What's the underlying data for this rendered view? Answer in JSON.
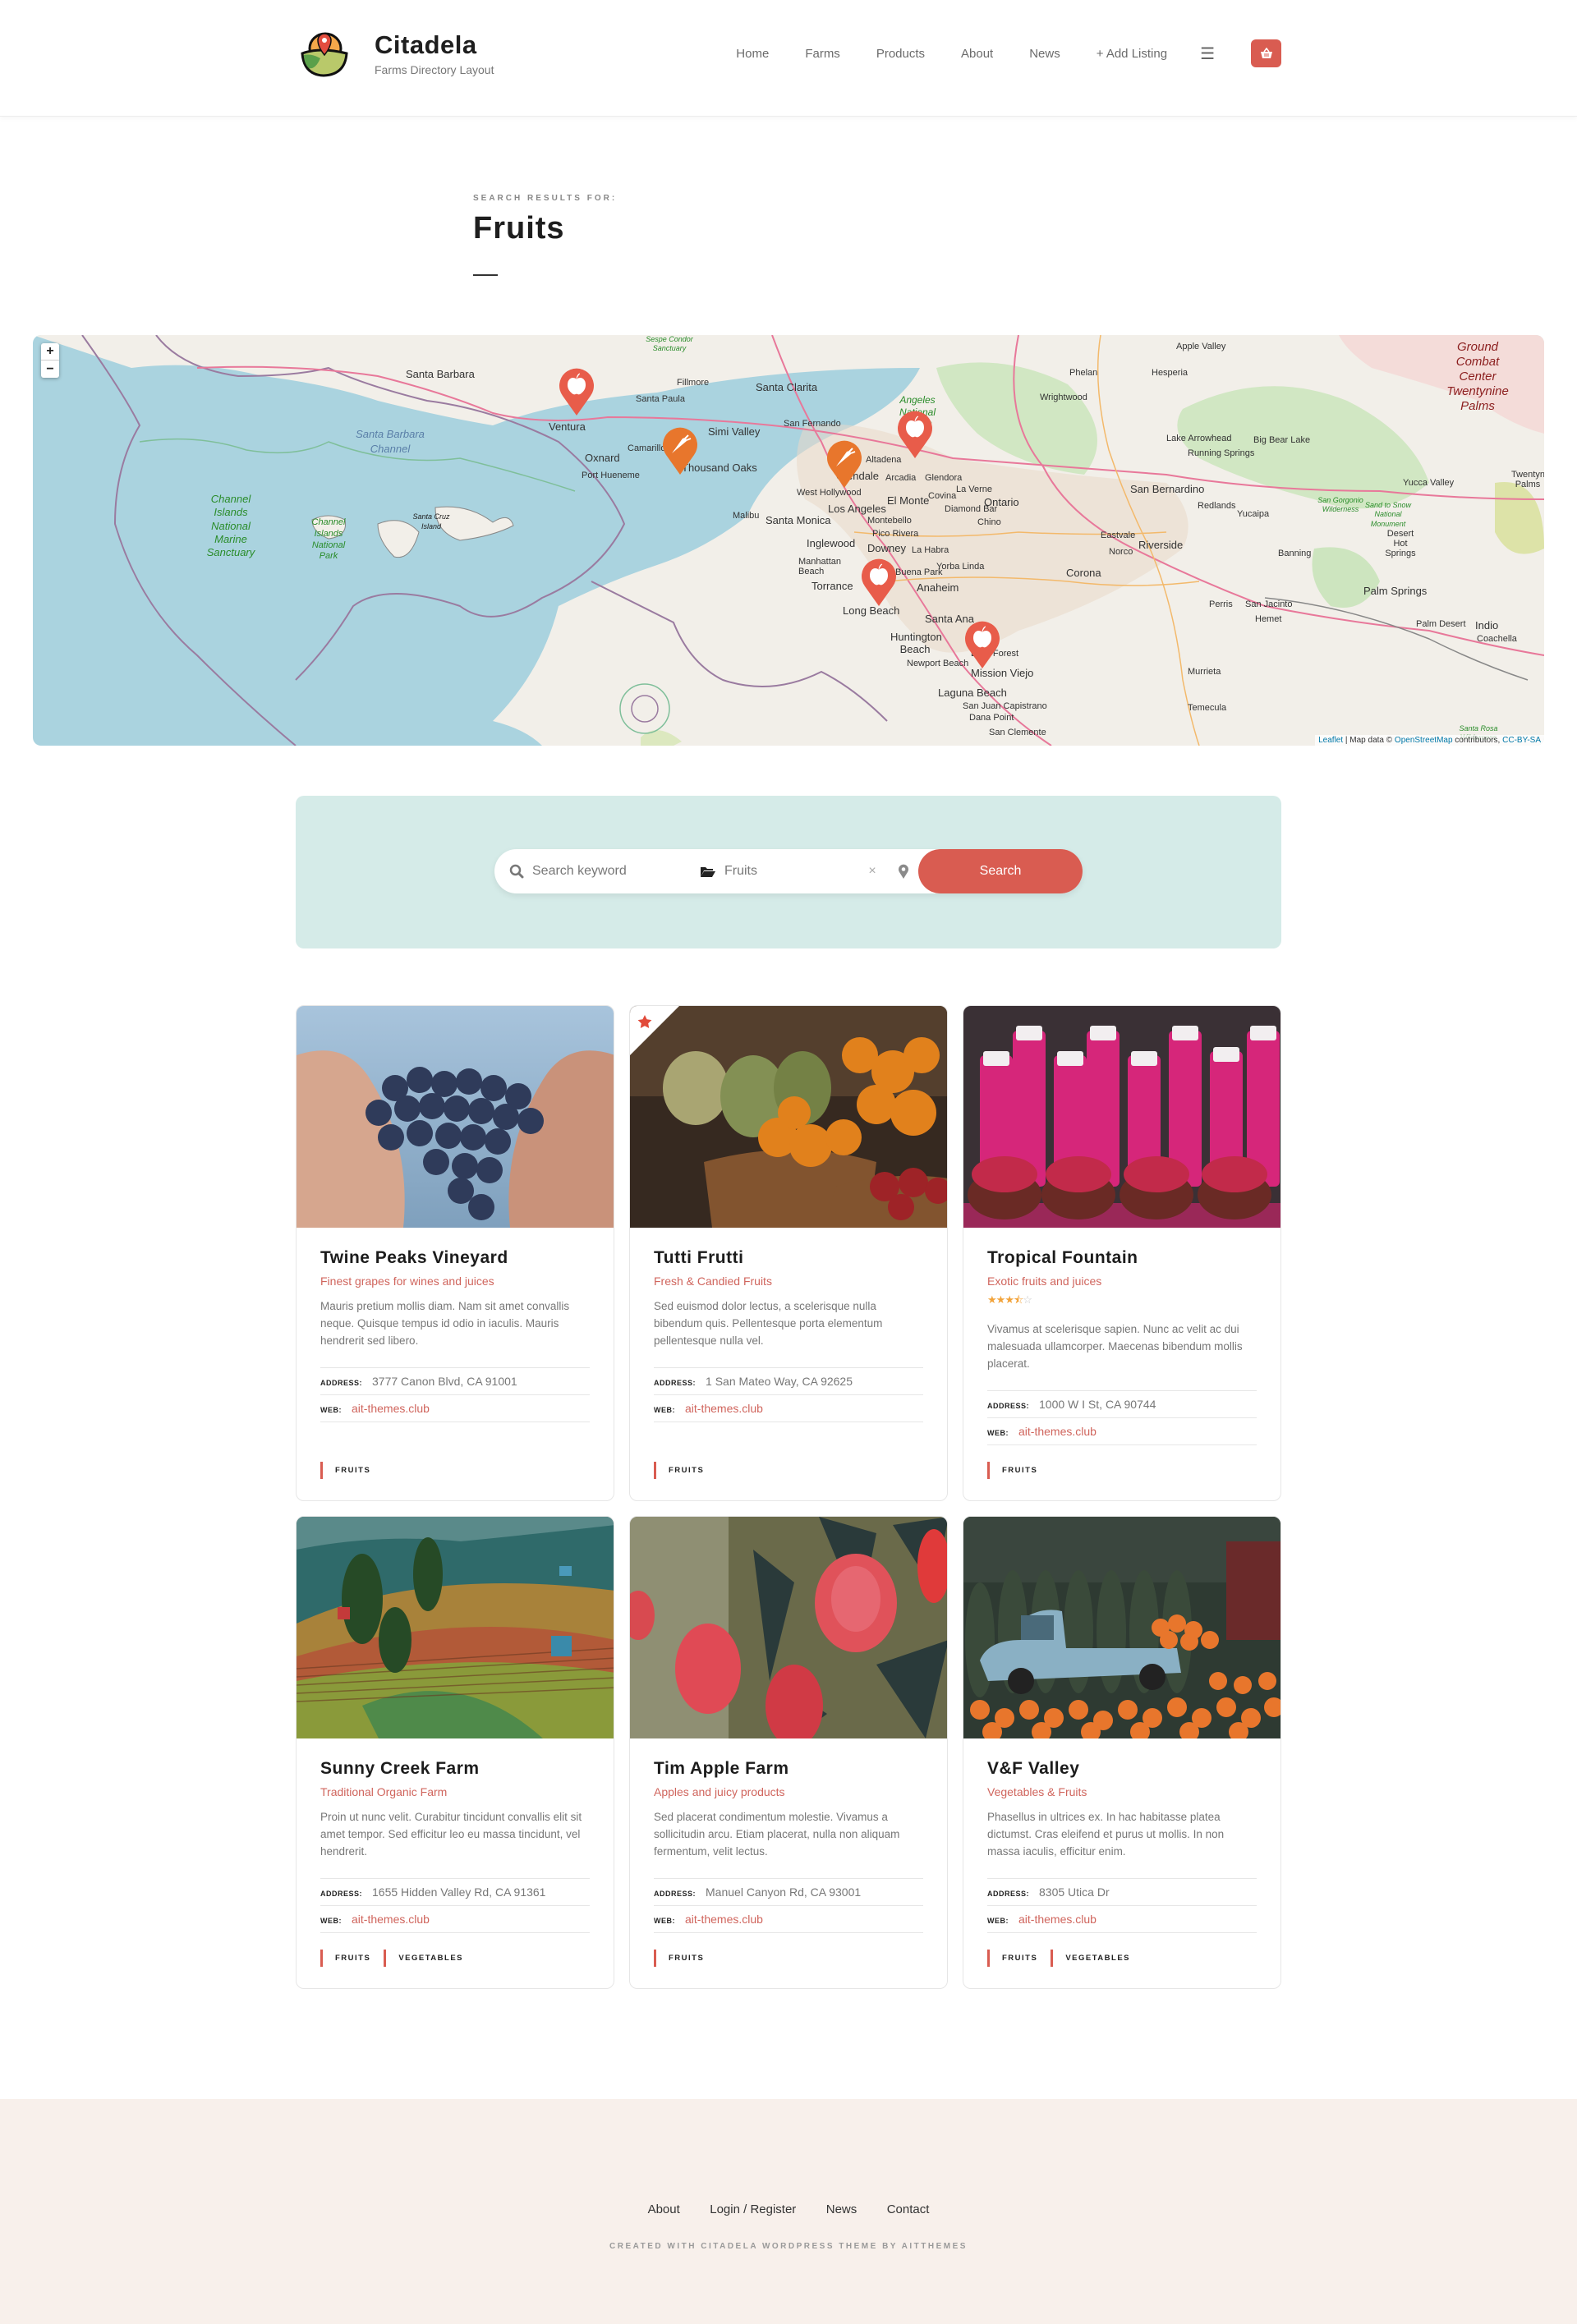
{
  "header": {
    "site_title": "Citadela",
    "site_subtitle": "Farms Directory Layout",
    "nav": [
      {
        "label": "Home"
      },
      {
        "label": "Farms"
      },
      {
        "label": "Products"
      },
      {
        "label": "About"
      },
      {
        "label": "News"
      },
      {
        "label": "+ Add Listing"
      }
    ],
    "menu_icon": "hamburger-icon",
    "cart_icon": "basket-icon",
    "accent_color": "#d95c51"
  },
  "page": {
    "eyebrow": "SEARCH RESULTS FOR:",
    "title": "Fruits"
  },
  "map": {
    "zoom_in": "+",
    "zoom_out": "−",
    "attribution": {
      "leaflet": "Leaflet",
      "sep": " | Map data © ",
      "osm": "OpenStreetMap",
      "contrib": " contributors, ",
      "license": "CC-BY-SA"
    },
    "labels": {
      "santa_barbara": "Santa Barbara",
      "sb_channel": "Santa Barbara Channel",
      "channel_sanctuary": "Channel Islands National Marine Sanctuary",
      "channel_park": "Channel Islands National Park",
      "santa_cruz": "Santa Cruz Island",
      "sespe": "Sespe Condor Sanctuary",
      "ventura": "Ventura",
      "oxnard": "Oxnard",
      "port_hueneme": "Port Hueneme",
      "camarillo": "Camarillo",
      "santa_paula": "Santa Paula",
      "fillmore": "Fillmore",
      "simi_valley": "Simi Valley",
      "thousand_oaks": "Thousand Oaks",
      "santa_clarita": "Santa Clarita",
      "san_fernando": "San Fernando",
      "malibu": "Malibu",
      "santa_monica": "Santa Monica",
      "west_hollywood": "West Hollywood",
      "glendale": "Glendale",
      "los_angeles": "Los Angeles",
      "altadena": "Altadena",
      "angeles_forest": "Angeles National Forest",
      "arcadia": "Arcadia",
      "glendora": "Glendora",
      "el_monte": "El Monte",
      "covina": "Covina",
      "la_verne": "La Verne",
      "montebello": "Montebello",
      "diamond_bar": "Diamond Bar",
      "chino": "Chino",
      "ontario": "Ontario",
      "pico_rivera": "Pico Rivera",
      "inglewood": "Inglewood",
      "downey": "Downey",
      "la_habra": "La Habra",
      "manhattan_beach": "Manhattan Beach",
      "torrance": "Torrance",
      "buena_park": "Buena Park",
      "yorba_linda": "Yorba Linda",
      "anaheim": "Anaheim",
      "long_beach": "Long Beach",
      "santa_ana": "Santa Ana",
      "huntington_beach": "Huntington Beach",
      "newport_beach": "Newport Beach",
      "lake_forest": "Lake Forest",
      "mission_viejo": "Mission Viejo",
      "laguna_beach": "Laguna Beach",
      "san_juan": "San Juan Capistrano",
      "dana_point": "Dana Point",
      "san_clemente": "San Clemente",
      "apple_valley": "Apple Valley",
      "phelan": "Phelan",
      "hesperia": "Hesperia",
      "wrightwood": "Wrightwood",
      "lake_arrowhead": "Lake Arrowhead",
      "big_bear": "Big Bear Lake",
      "running_springs": "Running Springs",
      "san_bernardino": "San Bernardino",
      "redlands": "Redlands",
      "yucaipa": "Yucaipa",
      "eastvale": "Eastvale",
      "riverside": "Riverside",
      "norco": "Norco",
      "corona": "Corona",
      "banning": "Banning",
      "san_gorgonio": "San Gorgonio Wilderness",
      "sand_to_snow": "Sand to Snow National Monument",
      "yucca_valley": "Yucca Valley",
      "desert_hot": "Desert Hot Springs",
      "palm_springs": "Palm Springs",
      "palm_desert": "Palm Desert",
      "indio": "Indio",
      "coachella": "Coachella",
      "temecula": "Temecula",
      "murrieta": "Murrieta",
      "perris": "Perris",
      "san_jacinto": "San Jacinto",
      "hemet": "Hemet",
      "santa_rosa": "Santa Rosa Wilderness",
      "combat_center": "Ground Combat Center Twentynine Palms",
      "twentynine": "Twentynine Palms"
    },
    "markers": [
      {
        "type": "apple",
        "color": "#e85c4a",
        "near": "Ventura"
      },
      {
        "type": "carrot",
        "color": "#e8762c",
        "near": "Thousand Oaks"
      },
      {
        "type": "carrot",
        "color": "#e8762c",
        "near": "West Hollywood"
      },
      {
        "type": "apple",
        "color": "#e85c4a",
        "near": "Altadena"
      },
      {
        "type": "apple",
        "color": "#e85c4a",
        "near": "Torrance"
      },
      {
        "type": "apple",
        "color": "#e85c4a",
        "near": "Newport Beach"
      }
    ]
  },
  "search": {
    "keyword_placeholder": "Search keyword",
    "category_value": "Fruits",
    "clear_label": "×",
    "button_label": "Search"
  },
  "listings": [
    {
      "name": "Twine Peaks Vineyard",
      "tagline": "Finest grapes for wines and juices",
      "description": "Mauris pretium mollis diam. Nam sit amet convallis neque. Quisque tempus id odio in iaculis. Mauris hendrerit sed libero.",
      "address_label": "ADDRESS:",
      "address": "3777 Canon Blvd, CA 91001",
      "web_label": "WEB:",
      "web": "ait-themes.club",
      "categories": [
        "FRUITS"
      ],
      "featured": false,
      "rating": null,
      "image": "grapes-in-hands"
    },
    {
      "name": "Tutti Frutti",
      "tagline": "Fresh & Candied Fruits",
      "description": "Sed euismod dolor lectus, a scelerisque nulla bibendum quis. Pellentesque porta elementum pellentesque nulla vel.",
      "address_label": "ADDRESS:",
      "address": "1 San Mateo Way, CA 92625",
      "web_label": "WEB:",
      "web": "ait-themes.club",
      "categories": [
        "FRUITS"
      ],
      "featured": true,
      "rating": null,
      "image": "fruit-market-baskets"
    },
    {
      "name": "Tropical Fountain",
      "tagline": "Exotic fruits and juices",
      "description": "Vivamus at scelerisque sapien. Nunc ac velit ac dui malesuada ullamcorper. Maecenas bibendum mollis placerat.",
      "address_label": "ADDRESS:",
      "address": "1000 W I St, CA 90744",
      "web_label": "WEB:",
      "web": "ait-themes.club",
      "categories": [
        "FRUITS"
      ],
      "featured": false,
      "rating": 3.5,
      "rating_max": 5,
      "image": "pomegranate-juice"
    },
    {
      "name": "Sunny Creek Farm",
      "tagline": "Traditional Organic Farm",
      "description": "Proin ut nunc velit. Curabitur tincidunt convallis elit sit amet tempor. Sed efficitur leo eu massa tincidunt, vel hendrerit.",
      "address_label": "ADDRESS:",
      "address": "1655 Hidden Valley Rd, CA 91361",
      "web_label": "WEB:",
      "web": "ait-themes.club",
      "categories": [
        "FRUITS",
        "VEGETABLES"
      ],
      "featured": false,
      "rating": null,
      "image": "terraced-fields"
    },
    {
      "name": "Tim Apple Farm",
      "tagline": "Apples and juicy products",
      "description": "Sed placerat condimentum molestie. Vivamus a sollicitudin arcu. Etiam placerat, nulla non aliquam fermentum, velit lectus.",
      "address_label": "ADDRESS:",
      "address": "Manuel Canyon Rd, CA 93001",
      "web_label": "WEB:",
      "web": "ait-themes.club",
      "categories": [
        "FRUITS"
      ],
      "featured": false,
      "rating": null,
      "image": "apples-on-tree"
    },
    {
      "name": "V&F Valley",
      "tagline": "Vegetables & Fruits",
      "description": "Phasellus in ultrices ex. In hac habitasse platea dictumst. Cras eleifend et purus ut mollis. In non massa iaculis, efficitur enim.",
      "address_label": "ADDRESS:",
      "address": "8305 Utica Dr",
      "web_label": "WEB:",
      "web": "ait-themes.club",
      "categories": [
        "FRUITS",
        "VEGETABLES"
      ],
      "featured": false,
      "rating": null,
      "image": "truck-with-pumpkins"
    }
  ],
  "footer": {
    "links": [
      {
        "label": "About"
      },
      {
        "label": "Login / Register"
      },
      {
        "label": "News"
      },
      {
        "label": "Contact"
      }
    ],
    "credit": "CREATED WITH CITADELA WORDPRESS THEME BY AITTHEMES"
  }
}
